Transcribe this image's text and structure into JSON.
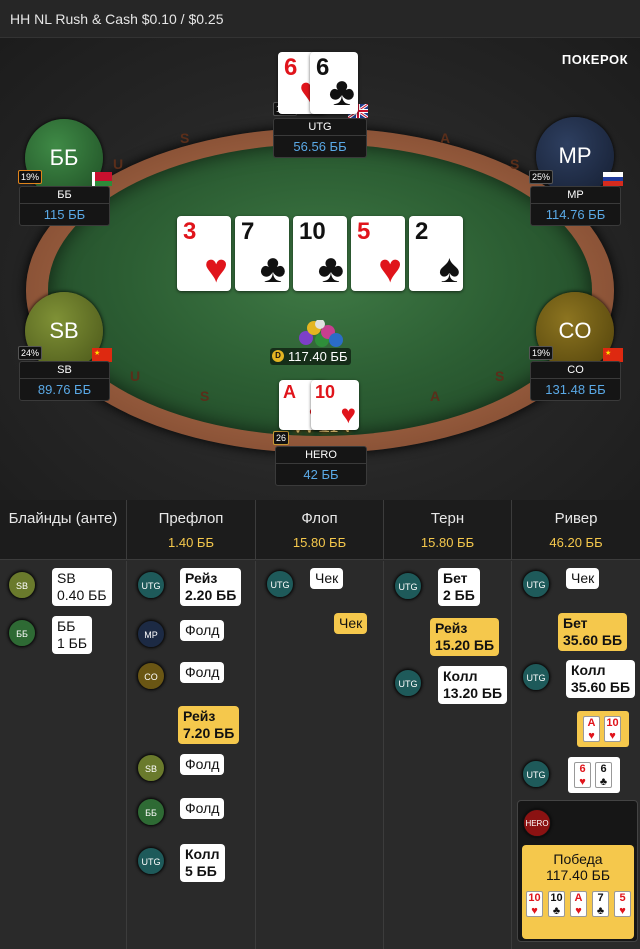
{
  "title": "HH NL Rush & Cash $0.10 / $0.25",
  "logo": "ПОКЕРОК",
  "seats": {
    "utg": {
      "name": "UTG",
      "stack": "56.56 ББ",
      "pct": "19%"
    },
    "bb": {
      "avatar": "ББ",
      "name": "ББ",
      "stack": "115 ББ",
      "pct": "19%"
    },
    "mp": {
      "avatar": "MP",
      "name": "MP",
      "stack": "114.76 ББ",
      "pct": "25%"
    },
    "sb": {
      "avatar": "SB",
      "name": "SB",
      "stack": "89.76 ББ",
      "pct": "24%"
    },
    "co": {
      "avatar": "CO",
      "name": "CO",
      "stack": "131.48 ББ",
      "pct": "19%"
    },
    "hero": {
      "name": "HERO",
      "stack": "42 ББ",
      "pct": "26"
    }
  },
  "utg_cards": [
    {
      "rank": "6",
      "suit": "♥"
    },
    {
      "rank": "6",
      "suit": "♣"
    }
  ],
  "hero_cards": [
    {
      "rank": "A",
      "suit": "♥"
    },
    {
      "rank": "10",
      "suit": "♥"
    }
  ],
  "board": [
    {
      "rank": "3",
      "suit": "♥"
    },
    {
      "rank": "7",
      "suit": "♣"
    },
    {
      "rank": "10",
      "suit": "♣"
    },
    {
      "rank": "5",
      "suit": "♥"
    },
    {
      "rank": "2",
      "suit": "♠"
    }
  ],
  "pot": "117.40 ББ",
  "dealer_icon": "D",
  "win_label": "WIN",
  "rail_letters": [
    "U",
    "S",
    "A",
    "S",
    "U",
    "S",
    "A",
    "S"
  ],
  "columns": [
    {
      "title": "Блайнды (анте)",
      "value": ""
    },
    {
      "title": "Префлоп",
      "value": "1.40 ББ"
    },
    {
      "title": "Флоп",
      "value": "15.80 ББ"
    },
    {
      "title": "Терн",
      "value": "15.80 ББ"
    },
    {
      "title": "Ривер",
      "value": "46.20 ББ"
    }
  ],
  "blinds": [
    {
      "pos": "SB",
      "l1": "SB",
      "l2": "0.40 ББ"
    },
    {
      "pos": "ББ",
      "l1": "ББ",
      "l2": "1 ББ"
    }
  ],
  "preflop": [
    {
      "pos": "UTG",
      "l1": "Рейз",
      "l2": "2.20 ББ"
    },
    {
      "pos": "MP",
      "l1": "Фолд"
    },
    {
      "pos": "CO",
      "l1": "Фолд"
    },
    {
      "hero": true,
      "l1": "Рейз",
      "l2": "7.20 ББ"
    },
    {
      "pos": "SB",
      "l1": "Фолд"
    },
    {
      "pos": "ББ",
      "l1": "Фолд"
    },
    {
      "pos": "UTG",
      "l1": "Колл",
      "l2": "5 ББ"
    }
  ],
  "flop": [
    {
      "pos": "UTG",
      "l1": "Чек"
    },
    {
      "hero": true,
      "l1": "Чек"
    }
  ],
  "turn": [
    {
      "pos": "UTG",
      "l1": "Бет",
      "l2": "2 ББ"
    },
    {
      "hero": true,
      "l1": "Рейз",
      "l2": "15.20 ББ"
    },
    {
      "pos": "UTG",
      "l1": "Колл",
      "l2": "13.20 ББ"
    }
  ],
  "river": [
    {
      "pos": "UTG",
      "l1": "Чек"
    },
    {
      "hero": true,
      "l1": "Бет",
      "l2": "35.60 ББ"
    },
    {
      "pos": "UTG",
      "l1": "Колл",
      "l2": "35.60 ББ"
    }
  ],
  "river_hero_show": [
    {
      "rank": "A",
      "suit": "♥"
    },
    {
      "rank": "10",
      "suit": "♥"
    }
  ],
  "river_utg_show": [
    {
      "rank": "6",
      "suit": "♥"
    },
    {
      "rank": "6",
      "suit": "♣"
    }
  ],
  "winner": {
    "label": "HERO",
    "text": "Победа",
    "amount": "117.40 ББ"
  },
  "winning_hand": [
    {
      "rank": "10",
      "suit": "♥"
    },
    {
      "rank": "10",
      "suit": "♣"
    },
    {
      "rank": "A",
      "suit": "♥"
    },
    {
      "rank": "7",
      "suit": "♣"
    },
    {
      "rank": "5",
      "suit": "♥"
    }
  ],
  "colors": {
    "sb": "#6a7a2c",
    "bb": "#2e6a34",
    "mp": "#1c2a44",
    "co": "#6a5614",
    "utg": "#1e5a5a",
    "gold": "#f5c84c",
    "stack_blue": "#5aa9e6"
  }
}
